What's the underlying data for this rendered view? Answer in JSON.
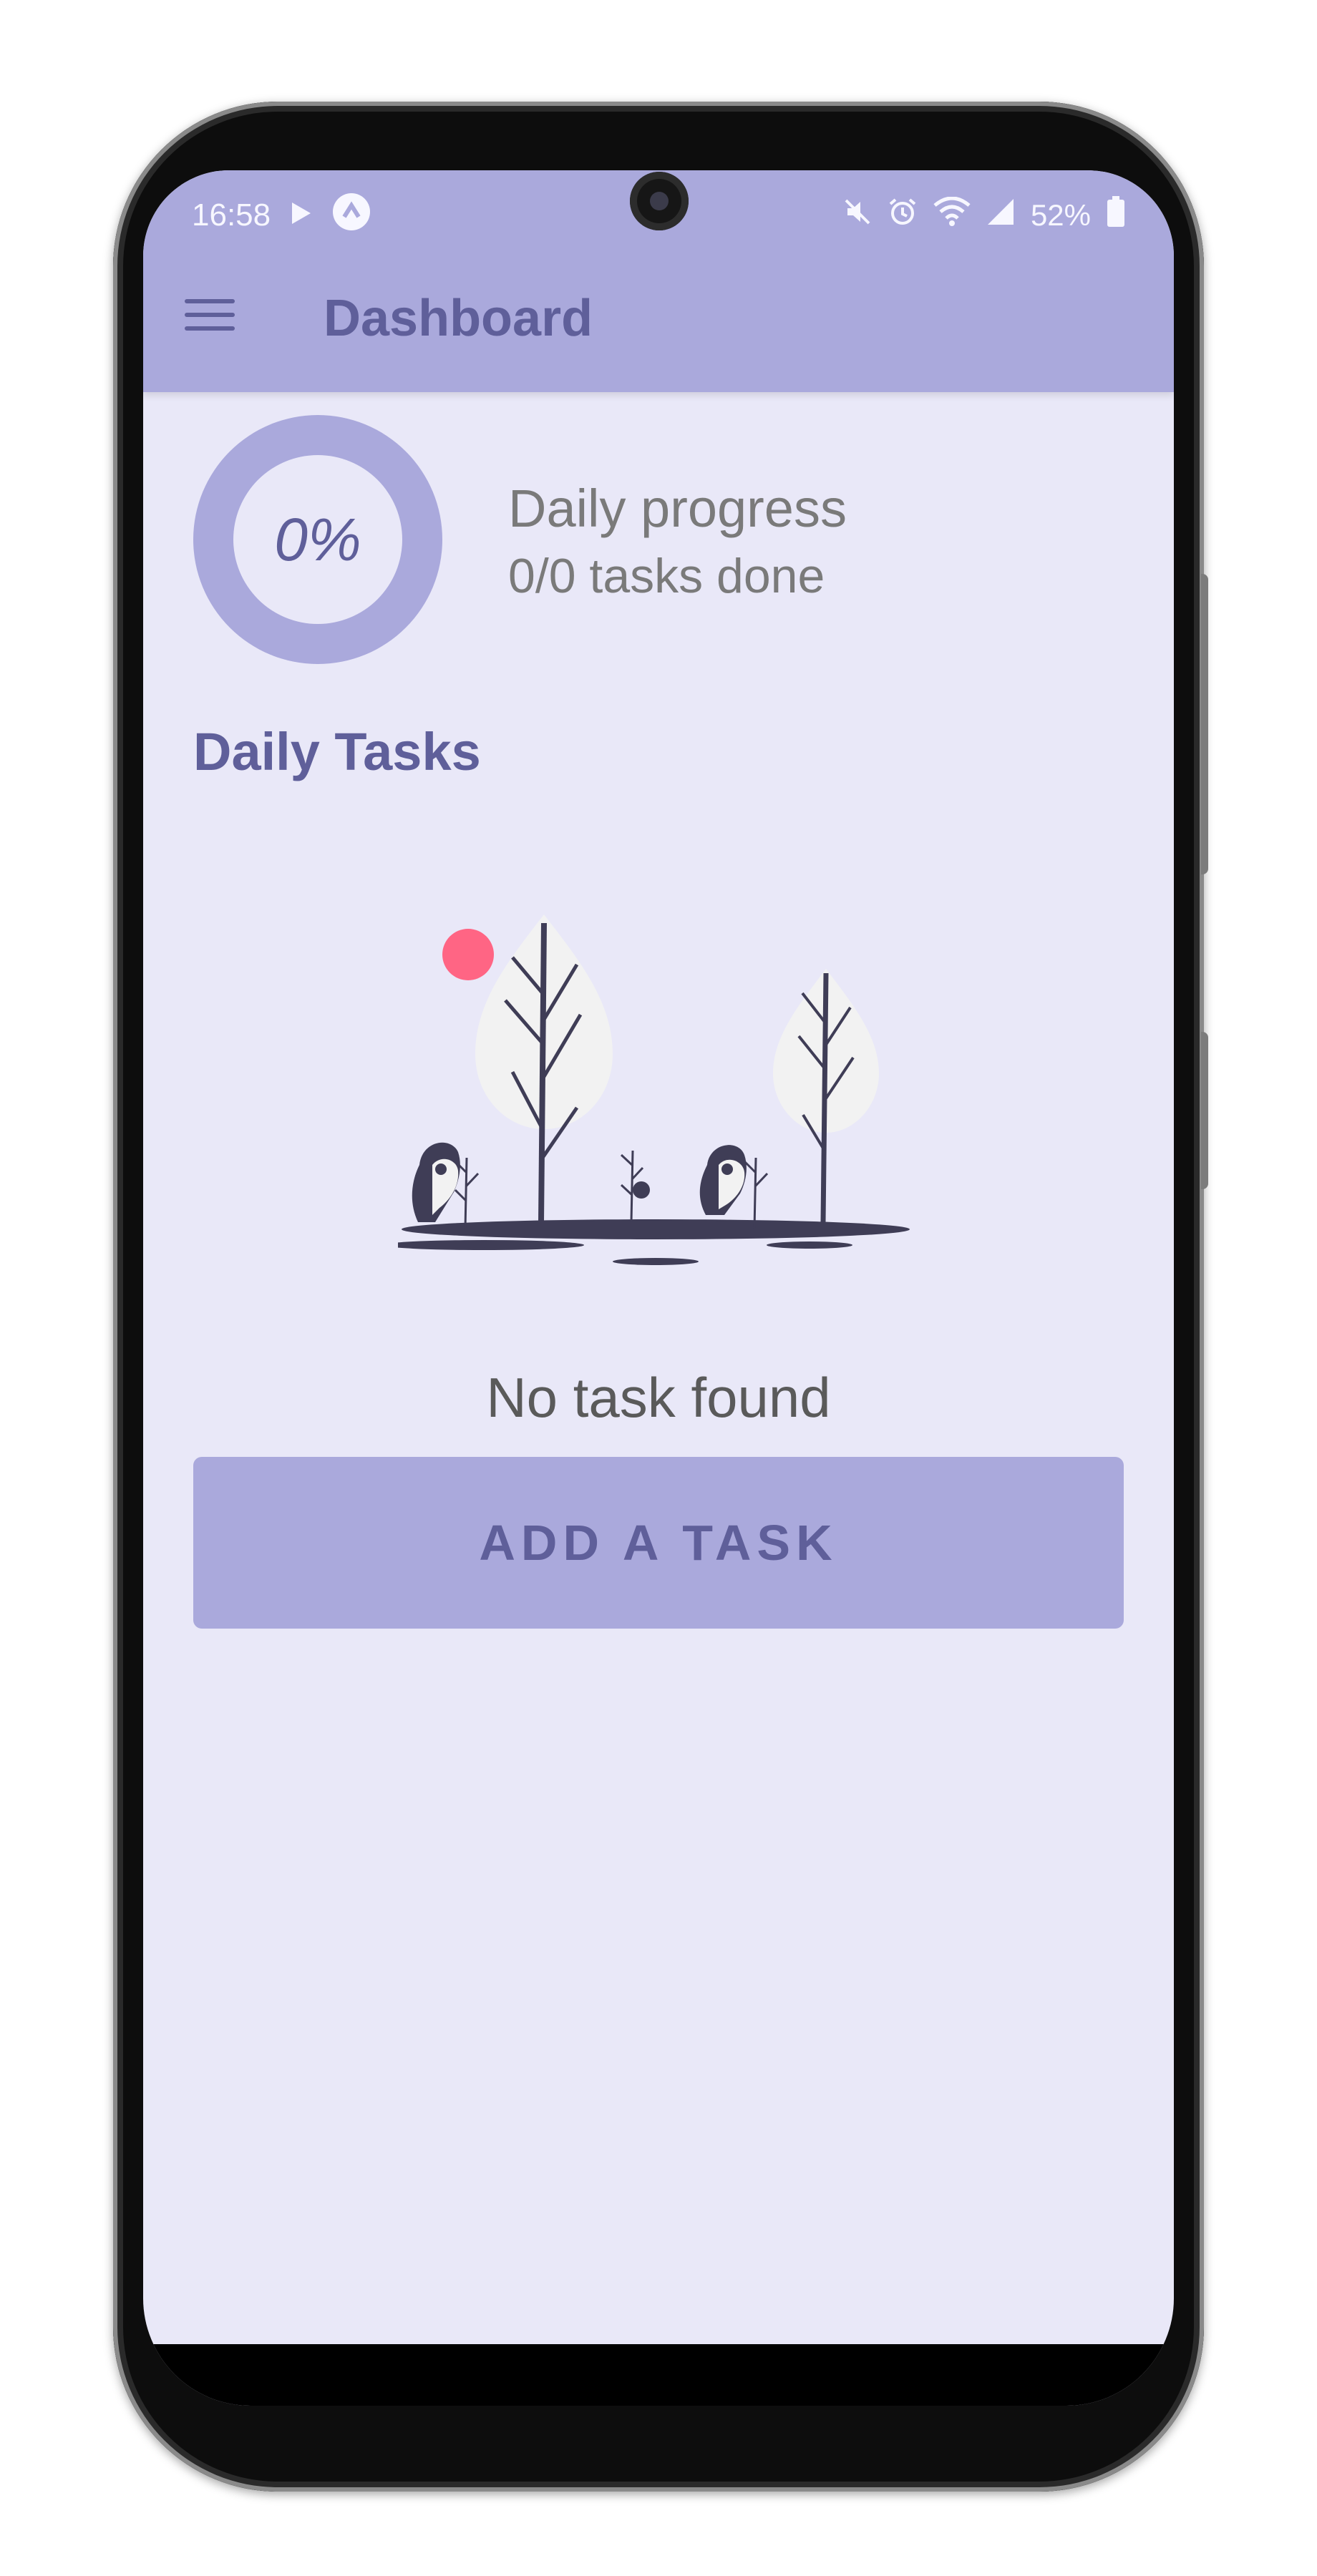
{
  "status_bar": {
    "time": "16:58",
    "battery": "52%",
    "icons": [
      "play-icon",
      "app-icon",
      "mute-icon",
      "alarm-icon",
      "wifi-icon",
      "signal-icon",
      "battery-icon"
    ]
  },
  "app_bar": {
    "title": "Dashboard",
    "menu_icon": "hamburger-menu-icon"
  },
  "progress": {
    "percent_label": "0%",
    "title": "Daily progress",
    "subtitle": "0/0 tasks done",
    "fraction_done": 0
  },
  "tasks": {
    "section_title": "Daily Tasks",
    "empty_message": "No task found",
    "add_button_label": "ADD A TASK"
  },
  "colors": {
    "accent": "#aaa9dc",
    "background": "#e9e8f8",
    "text_primary": "#5f5f9a",
    "illustration_dark": "#3f3d56",
    "illustration_sun": "#ff6584"
  }
}
